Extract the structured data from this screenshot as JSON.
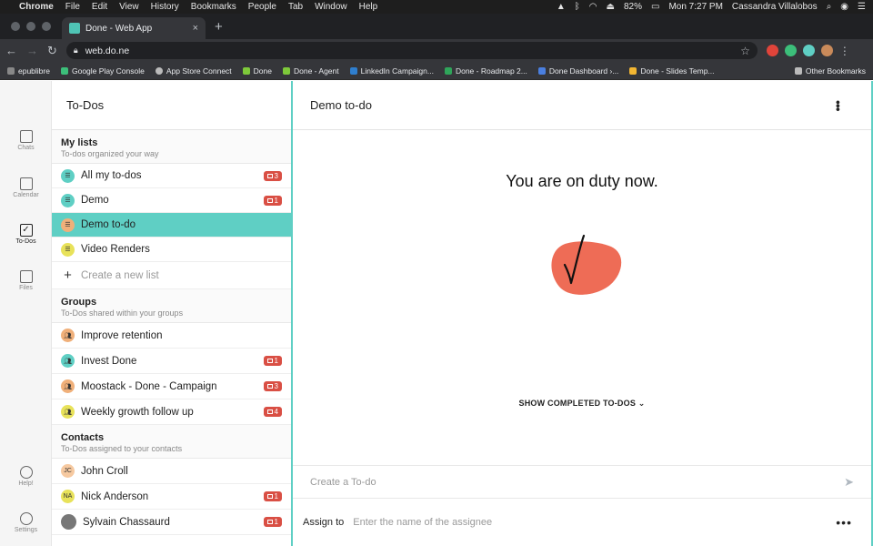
{
  "menubar": {
    "app": "Chrome",
    "items": [
      "File",
      "Edit",
      "View",
      "History",
      "Bookmarks",
      "People",
      "Tab",
      "Window",
      "Help"
    ],
    "battery": "82%",
    "clock": "Mon 7:27 PM",
    "user": "Cassandra Villalobos"
  },
  "browser": {
    "tab_title": "Done - Web App",
    "url": "web.do.ne",
    "bookmarks": [
      "epublibre",
      "Google Play Console",
      "App Store Connect",
      "Done",
      "Done - Agent",
      "LinkedIn Campaign...",
      "Done - Roadmap 2...",
      "Done Dashboard ›...",
      "Done - Slides Temp..."
    ],
    "other_bookmarks": "Other Bookmarks"
  },
  "rail": {
    "chats": "Chats",
    "calendar": "Calendar",
    "todos": "To-Dos",
    "files": "Files",
    "help": "Help!",
    "settings": "Settings"
  },
  "lists_panel": {
    "title": "To-Dos",
    "my_lists": {
      "title": "My lists",
      "subtitle": "To-dos organized your way",
      "items": [
        {
          "label": "All my to-dos",
          "badge": "3",
          "color": "#5fcfc4"
        },
        {
          "label": "Demo",
          "badge": "1",
          "color": "#5fcfc4"
        },
        {
          "label": "Demo to-do",
          "badge": "",
          "color": "#f0b07a"
        },
        {
          "label": "Video Renders",
          "badge": "",
          "color": "#e8e25a"
        }
      ],
      "create": "Create a new list"
    },
    "groups": {
      "title": "Groups",
      "subtitle": "To-Dos shared within your groups",
      "items": [
        {
          "label": "Improve retention",
          "badge": "",
          "color": "#f0b07a"
        },
        {
          "label": "Invest Done",
          "badge": "1",
          "color": "#5fcfc4"
        },
        {
          "label": "Moostack - Done - Campaign",
          "badge": "3",
          "color": "#f0b07a"
        },
        {
          "label": "Weekly growth follow up",
          "badge": "4",
          "color": "#e8e25a"
        }
      ]
    },
    "contacts": {
      "title": "Contacts",
      "subtitle": "To-Dos assigned to your contacts",
      "items": [
        {
          "label": "John Croll",
          "initials": "JC",
          "badge": "",
          "color": "#f6c9a0"
        },
        {
          "label": "Nick Anderson",
          "initials": "NA",
          "badge": "1",
          "color": "#e8e25a"
        },
        {
          "label": "Sylvain Chassaurd",
          "initials": "",
          "badge": "1",
          "color": "#777777"
        }
      ]
    }
  },
  "main": {
    "title": "Demo to-do",
    "empty_message": "You are on duty now.",
    "show_completed": "SHOW COMPLETED TO-DOS",
    "create_placeholder": "Create a To-do",
    "assign_label": "Assign to",
    "assign_placeholder": "Enter the name of the assignee"
  }
}
